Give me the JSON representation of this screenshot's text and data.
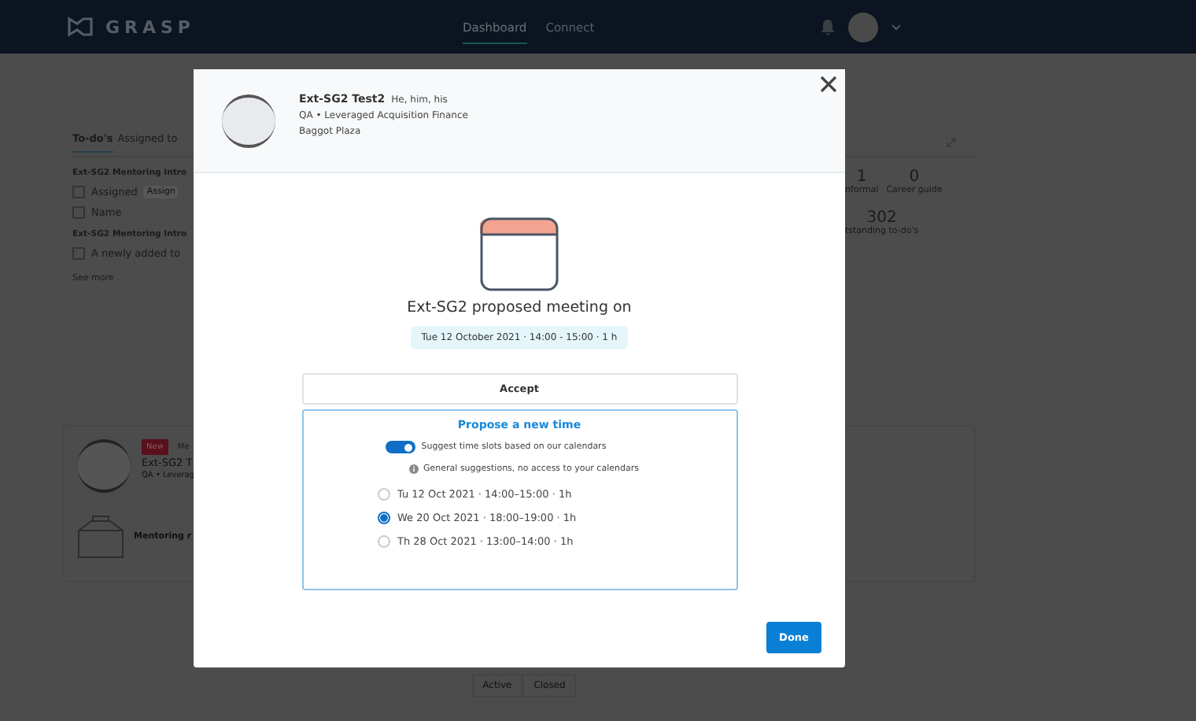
{
  "nav": {
    "logo": "GRASP",
    "links": [
      {
        "label": "Dashboard",
        "selected": true
      },
      {
        "label": "Connect",
        "selected": false
      }
    ]
  },
  "background": {
    "tabs": [
      {
        "label": "To-do's",
        "selected": true
      },
      {
        "label": "Assigned to",
        "selected": false
      }
    ],
    "todo_groups": [
      {
        "title": "Ext-SG2 Mentoring Intro",
        "items": [
          {
            "label": "Assigned",
            "chip": "Assign",
            "checked": false
          },
          {
            "label": "Name",
            "checked": false
          }
        ]
      },
      {
        "title": "Ext-SG2 Mentoring Intro",
        "items": [
          {
            "label": "A newly added to",
            "checked": false
          }
        ]
      }
    ],
    "see_more": "See more",
    "stat_rows": [
      [
        {
          "value": "1",
          "label": "nformal"
        },
        {
          "value": "0",
          "label": "Career guide"
        }
      ],
      [
        {
          "value": "302",
          "label": "tstanding to-do's"
        }
      ]
    ],
    "card": {
      "badge": "New",
      "tag": "Me",
      "name": "Ext-SG2 T",
      "subtitle": "QA • Leverag",
      "message": "Mentoring r"
    },
    "filter_tabs": [
      "Active",
      "Closed"
    ]
  },
  "modal": {
    "profile": {
      "name": "Ext-SG2 Test2",
      "pronouns": "He, him, his",
      "role": "QA • Leveraged Acquisition Finance",
      "location": "Baggot Plaza"
    },
    "title": "Ext-SG2 proposed meeting on",
    "proposed_time": "Tue 12 October 2021 · 14:00 - 15:00 · 1 h",
    "accept": "Accept",
    "propose": {
      "title": "Propose a new time",
      "toggle": {
        "label": "Suggest time slots based on our calendars",
        "on": true
      },
      "info": "General suggestions, no access to your calendars",
      "options": [
        {
          "label": "Tu 12 Oct 2021 · 14:00–15:00 · 1h",
          "selected": false
        },
        {
          "label": "We 20 Oct 2021 · 18:00–19:00 · 1h",
          "selected": true
        },
        {
          "label": "Th 28 Oct 2021 · 13:00–14:00 · 1h",
          "selected": false
        }
      ]
    },
    "done": "Done"
  }
}
